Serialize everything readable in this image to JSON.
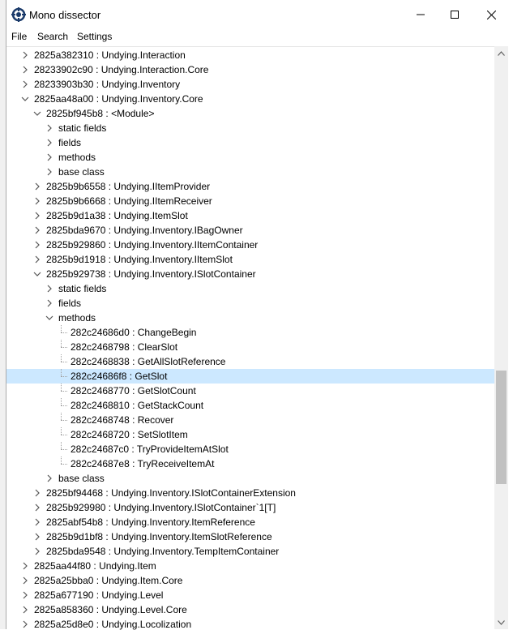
{
  "window": {
    "title": "Mono dissector"
  },
  "menu": {
    "file": "File",
    "search": "Search",
    "settings": "Settings"
  },
  "tree": [
    {
      "level": 0,
      "state": "collapsed",
      "label": "2825a382310 : Undying.Interaction"
    },
    {
      "level": 0,
      "state": "collapsed",
      "label": "28233902c90 : Undying.Interaction.Core"
    },
    {
      "level": 0,
      "state": "collapsed",
      "label": "28233903b30 : Undying.Inventory"
    },
    {
      "level": 0,
      "state": "expanded",
      "label": "2825aa48a00 : Undying.Inventory.Core"
    },
    {
      "level": 1,
      "state": "expanded",
      "label": "2825bf945b8 : <Module>"
    },
    {
      "level": 2,
      "state": "collapsed",
      "label": "static fields"
    },
    {
      "level": 2,
      "state": "collapsed",
      "label": "fields"
    },
    {
      "level": 2,
      "state": "collapsed",
      "label": "methods"
    },
    {
      "level": 2,
      "state": "collapsed",
      "label": "base class"
    },
    {
      "level": 1,
      "state": "collapsed",
      "label": "2825b9b6558 : Undying.IItemProvider"
    },
    {
      "level": 1,
      "state": "collapsed",
      "label": "2825b9b6668 : Undying.IItemReceiver"
    },
    {
      "level": 1,
      "state": "collapsed",
      "label": "2825b9d1a38 : Undying.ItemSlot"
    },
    {
      "level": 1,
      "state": "collapsed",
      "label": "2825bda9670 : Undying.Inventory.IBagOwner"
    },
    {
      "level": 1,
      "state": "collapsed",
      "label": "2825b929860 : Undying.Inventory.IItemContainer"
    },
    {
      "level": 1,
      "state": "collapsed",
      "label": "2825b9d1918 : Undying.Inventory.IItemSlot"
    },
    {
      "level": 1,
      "state": "expanded",
      "label": "2825b929738 : Undying.Inventory.ISlotContainer"
    },
    {
      "level": 2,
      "state": "collapsed",
      "label": "static fields"
    },
    {
      "level": 2,
      "state": "collapsed",
      "label": "fields"
    },
    {
      "level": 2,
      "state": "expanded",
      "label": "methods"
    },
    {
      "level": 3,
      "state": "leaf",
      "label": "282c24686d0 : ChangeBegin"
    },
    {
      "level": 3,
      "state": "leaf",
      "label": "282c2468798 : ClearSlot"
    },
    {
      "level": 3,
      "state": "leaf",
      "label": "282c2468838 : GetAllSlotReference"
    },
    {
      "level": 3,
      "state": "leaf",
      "label": "282c24686f8 : GetSlot",
      "selected": true
    },
    {
      "level": 3,
      "state": "leaf",
      "label": "282c2468770 : GetSlotCount"
    },
    {
      "level": 3,
      "state": "leaf",
      "label": "282c2468810 : GetStackCount"
    },
    {
      "level": 3,
      "state": "leaf",
      "label": "282c2468748 : Recover"
    },
    {
      "level": 3,
      "state": "leaf",
      "label": "282c2468720 : SetSlotItem"
    },
    {
      "level": 3,
      "state": "leaf",
      "label": "282c24687c0 : TryProvideItemAtSlot"
    },
    {
      "level": 3,
      "state": "leaf",
      "label": "282c24687e8 : TryReceiveItemAt"
    },
    {
      "level": 2,
      "state": "collapsed",
      "label": "base class"
    },
    {
      "level": 1,
      "state": "collapsed",
      "label": "2825bf94468 : Undying.Inventory.ISlotContainerExtension"
    },
    {
      "level": 1,
      "state": "collapsed",
      "label": "2825b929980 : Undying.Inventory.ISlotContainer`1[T]"
    },
    {
      "level": 1,
      "state": "collapsed",
      "label": "2825abf54b8 : Undying.Inventory.ItemReference"
    },
    {
      "level": 1,
      "state": "collapsed",
      "label": "2825b9d1bf8 : Undying.Inventory.ItemSlotReference"
    },
    {
      "level": 1,
      "state": "collapsed",
      "label": "2825bda9548 : Undying.Inventory.TempItemContainer"
    },
    {
      "level": 0,
      "state": "collapsed",
      "label": "2825aa44f80 : Undying.Item"
    },
    {
      "level": 0,
      "state": "collapsed",
      "label": "2825a25bba0 : Undying.Item.Core"
    },
    {
      "level": 0,
      "state": "collapsed",
      "label": "2825a677190 : Undying.Level"
    },
    {
      "level": 0,
      "state": "collapsed",
      "label": "2825a858360 : Undying.Level.Core"
    },
    {
      "level": 0,
      "state": "collapsed",
      "label": "2825a25d8e0 : Undying.Locolization"
    }
  ],
  "colors": {
    "selection": "#cce8ff",
    "scrollbar_thumb": "#c1c1c1"
  }
}
